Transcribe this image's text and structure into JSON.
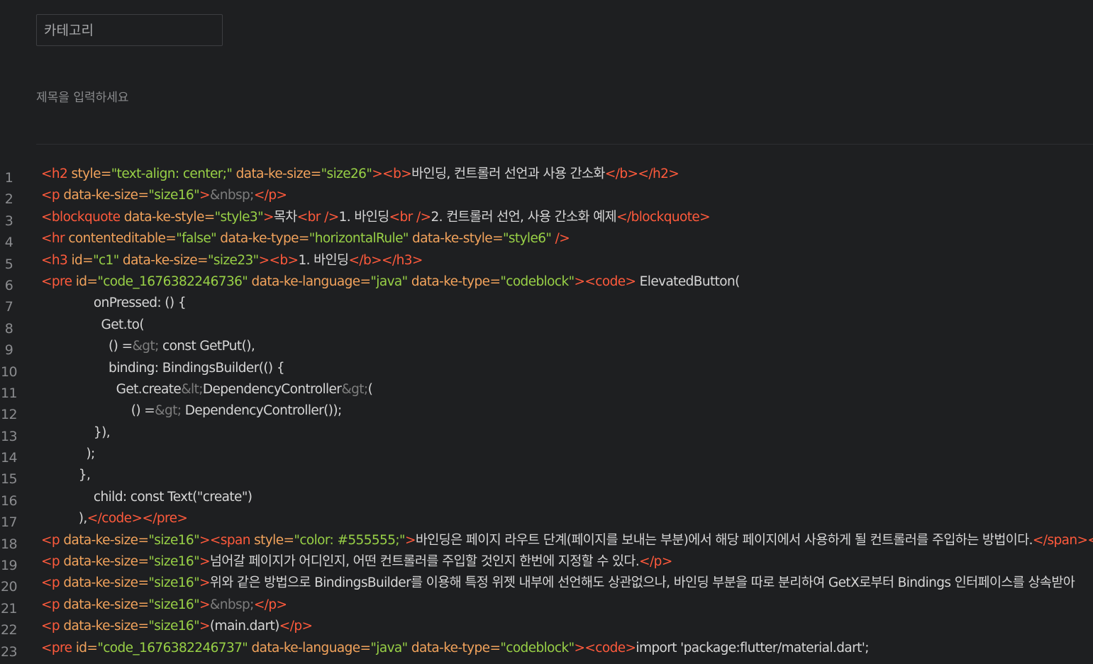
{
  "category": {
    "placeholder": "카테고리"
  },
  "title": {
    "placeholder": "제목을 입력하세요"
  },
  "colors": {
    "background": "#1e1f21",
    "tag": "#ff5a3c",
    "attribute": "#f2a35c",
    "string": "#98d046",
    "entity": "#7d7d7d",
    "text": "#d6d6d6",
    "line_number": "#8b8c8f"
  },
  "editor": {
    "lines": [
      {
        "n": "1",
        "segments": [
          [
            "tag",
            "<h2 "
          ],
          [
            "attr",
            "style="
          ],
          [
            "str",
            "\"text-align: center;\" "
          ],
          [
            "attr",
            "data-ke-size="
          ],
          [
            "str",
            "\"size26\""
          ],
          [
            "tag",
            "><b>"
          ],
          [
            "txt",
            "바인딩, 컨트롤러 선언과 사용 간소화"
          ],
          [
            "tag",
            "</b></h2>"
          ]
        ]
      },
      {
        "n": "2",
        "segments": [
          [
            "tag",
            "<p "
          ],
          [
            "attr",
            "data-ke-size="
          ],
          [
            "str",
            "\"size16\""
          ],
          [
            "tag",
            ">"
          ],
          [
            "ent",
            "&nbsp;"
          ],
          [
            "tag",
            "</p>"
          ]
        ]
      },
      {
        "n": "3",
        "segments": [
          [
            "tag",
            "<blockquote "
          ],
          [
            "attr",
            "data-ke-style="
          ],
          [
            "str",
            "\"style3\""
          ],
          [
            "tag",
            ">"
          ],
          [
            "txt",
            "목차"
          ],
          [
            "tag",
            "<br />"
          ],
          [
            "txt",
            "1. 바인딩"
          ],
          [
            "tag",
            "<br />"
          ],
          [
            "txt",
            "2. 컨트롤러 선언, 사용 간소화 예제"
          ],
          [
            "tag",
            "</blockquote>"
          ]
        ]
      },
      {
        "n": "4",
        "segments": [
          [
            "tag",
            "<hr "
          ],
          [
            "attr",
            "contenteditable="
          ],
          [
            "str",
            "\"false\" "
          ],
          [
            "attr",
            "data-ke-type="
          ],
          [
            "str",
            "\"horizontalRule\" "
          ],
          [
            "attr",
            "data-ke-style="
          ],
          [
            "str",
            "\"style6\" "
          ],
          [
            "tag",
            "/>"
          ]
        ]
      },
      {
        "n": "5",
        "segments": [
          [
            "tag",
            "<h3 "
          ],
          [
            "attr",
            "id="
          ],
          [
            "str",
            "\"c1\" "
          ],
          [
            "attr",
            "data-ke-size="
          ],
          [
            "str",
            "\"size23\""
          ],
          [
            "tag",
            "><b>"
          ],
          [
            "txt",
            "1. 바인딩"
          ],
          [
            "tag",
            "</b></h3>"
          ]
        ]
      },
      {
        "n": "6",
        "segments": [
          [
            "tag",
            "<pre "
          ],
          [
            "attr",
            "id="
          ],
          [
            "str",
            "\"code_1676382246736\" "
          ],
          [
            "attr",
            "data-ke-language="
          ],
          [
            "str",
            "\"java\" "
          ],
          [
            "attr",
            "data-ke-type="
          ],
          [
            "str",
            "\"codeblock\""
          ],
          [
            "tag",
            "><code>"
          ],
          [
            "txt",
            " ElevatedButton("
          ]
        ]
      },
      {
        "n": "7",
        "segments": [
          [
            "txt",
            "              onPressed: () {"
          ]
        ]
      },
      {
        "n": "8",
        "segments": [
          [
            "txt",
            "                Get.to("
          ]
        ]
      },
      {
        "n": "9",
        "segments": [
          [
            "txt",
            "                  () ="
          ],
          [
            "ent",
            "&gt;"
          ],
          [
            "txt",
            " const GetPut(),"
          ]
        ]
      },
      {
        "n": "10",
        "segments": [
          [
            "txt",
            "                  binding: BindingsBuilder(() {"
          ]
        ]
      },
      {
        "n": "11",
        "segments": [
          [
            "txt",
            "                    Get.create"
          ],
          [
            "ent",
            "&lt;"
          ],
          [
            "txt",
            "DependencyController"
          ],
          [
            "ent",
            "&gt;"
          ],
          [
            "txt",
            "("
          ]
        ]
      },
      {
        "n": "12",
        "segments": [
          [
            "txt",
            "                        () ="
          ],
          [
            "ent",
            "&gt;"
          ],
          [
            "txt",
            " DependencyController());"
          ]
        ]
      },
      {
        "n": "13",
        "segments": [
          [
            "txt",
            "              }),"
          ]
        ]
      },
      {
        "n": "14",
        "segments": [
          [
            "txt",
            "            );"
          ]
        ]
      },
      {
        "n": "15",
        "segments": [
          [
            "txt",
            "          },"
          ]
        ]
      },
      {
        "n": "16",
        "segments": [
          [
            "txt",
            "              child: const Text(\"create\")"
          ]
        ]
      },
      {
        "n": "17",
        "segments": [
          [
            "txt",
            "          ),"
          ],
          [
            "tag",
            "</code></pre>"
          ]
        ]
      },
      {
        "n": "18",
        "segments": [
          [
            "tag",
            "<p "
          ],
          [
            "attr",
            "data-ke-size="
          ],
          [
            "str",
            "\"size16\""
          ],
          [
            "tag",
            "><span "
          ],
          [
            "attr",
            "style="
          ],
          [
            "str",
            "\"color: #555555;\""
          ],
          [
            "tag",
            ">"
          ],
          [
            "txt",
            "바인딩은 페이지 라우트 단계(페이지를 보내는 부분)에서 해당 페이지에서 사용하게 될 컨트롤러를 주입하는 방법이다."
          ],
          [
            "tag",
            "</span></p>"
          ]
        ]
      },
      {
        "n": "19",
        "segments": [
          [
            "tag",
            "<p "
          ],
          [
            "attr",
            "data-ke-size="
          ],
          [
            "str",
            "\"size16\""
          ],
          [
            "tag",
            ">"
          ],
          [
            "txt",
            "넘어갈 페이지가 어디인지, 어떤 컨트롤러를 주입할 것인지 한번에 지정할 수 있다."
          ],
          [
            "tag",
            "</p>"
          ]
        ]
      },
      {
        "n": "20",
        "segments": [
          [
            "tag",
            "<p "
          ],
          [
            "attr",
            "data-ke-size="
          ],
          [
            "str",
            "\"size16\""
          ],
          [
            "tag",
            ">"
          ],
          [
            "txt",
            "위와 같은 방법으로 BindingsBuilder를 이용해 특정 위젯 내부에 선언해도 상관없으나, 바인딩 부분을 따로 분리하여 GetX로부터 Bindings 인터페이스를 상속받아"
          ]
        ]
      },
      {
        "n": "21",
        "segments": [
          [
            "tag",
            "<p "
          ],
          [
            "attr",
            "data-ke-size="
          ],
          [
            "str",
            "\"size16\""
          ],
          [
            "tag",
            ">"
          ],
          [
            "ent",
            "&nbsp;"
          ],
          [
            "tag",
            "</p>"
          ]
        ]
      },
      {
        "n": "22",
        "segments": [
          [
            "tag",
            "<p "
          ],
          [
            "attr",
            "data-ke-size="
          ],
          [
            "str",
            "\"size16\""
          ],
          [
            "tag",
            ">"
          ],
          [
            "txt",
            "(main.dart)"
          ],
          [
            "tag",
            "</p>"
          ]
        ]
      },
      {
        "n": "23",
        "segments": [
          [
            "tag",
            "<pre "
          ],
          [
            "attr",
            "id="
          ],
          [
            "str",
            "\"code_1676382246737\" "
          ],
          [
            "attr",
            "data-ke-language="
          ],
          [
            "str",
            "\"java\" "
          ],
          [
            "attr",
            "data-ke-type="
          ],
          [
            "str",
            "\"codeblock\""
          ],
          [
            "tag",
            "><code>"
          ],
          [
            "txt",
            "import 'package:flutter/material.dart';"
          ]
        ]
      }
    ]
  }
}
